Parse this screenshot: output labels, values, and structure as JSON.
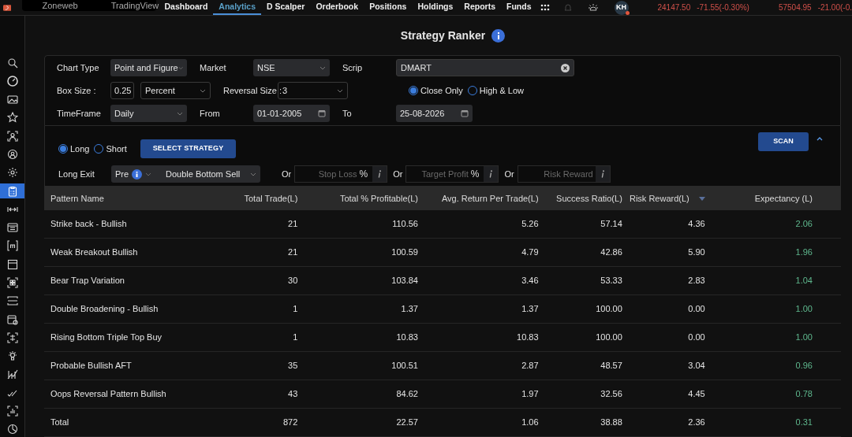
{
  "top_bar": {
    "shortcuts": [
      "Zoneweb",
      "TradingView"
    ],
    "nav": [
      {
        "label": "Dashboard",
        "selected": false
      },
      {
        "label": "Analytics",
        "selected": true
      },
      {
        "label": "D Scalper",
        "selected": false
      },
      {
        "label": "Orderbook",
        "selected": false
      },
      {
        "label": "Positions",
        "selected": false
      },
      {
        "label": "Holdings",
        "selected": false
      },
      {
        "label": "Reports",
        "selected": false
      },
      {
        "label": "Funds",
        "selected": false
      }
    ],
    "avatar": "KH",
    "tickers": [
      {
        "price": "24147.50",
        "change": "-71.55(-0.30%)"
      },
      {
        "price": "57504.95",
        "change": "-21.00(-0."
      }
    ]
  },
  "sidebar": {
    "items": [
      {
        "selected": false
      },
      {
        "selected": false
      },
      {
        "selected": false
      },
      {
        "selected": false
      },
      {
        "selected": false
      },
      {
        "selected": false
      },
      {
        "selected": false
      },
      {
        "selected": true
      },
      {
        "selected": false
      },
      {
        "selected": false
      },
      {
        "selected": false
      },
      {
        "selected": false
      },
      {
        "selected": false
      },
      {
        "selected": false
      },
      {
        "selected": false
      },
      {
        "selected": false
      },
      {
        "selected": false
      },
      {
        "selected": false
      },
      {
        "selected": false
      },
      {
        "selected": false
      },
      {
        "selected": false
      }
    ]
  },
  "title": "Strategy Ranker",
  "settings": {
    "chart_type": {
      "label": "Chart Type",
      "value": "Point and Figure"
    },
    "market": {
      "label": "Market",
      "value": "NSE"
    },
    "scrip": {
      "label": "Scrip",
      "value": "DMART"
    },
    "box_size": {
      "label": "Box Size :",
      "value": "0.25",
      "unit": "Percent"
    },
    "reversal_size": {
      "label": "Reversal Size :",
      "value": "3"
    },
    "price_mode": [
      {
        "label": "Close Only",
        "selected": true
      },
      {
        "label": "High & Low",
        "selected": false
      }
    ],
    "timeframe": {
      "label": "TimeFrame",
      "value": "Daily"
    },
    "from": {
      "label": "From",
      "value": "01-01-2005"
    },
    "to": {
      "label": "To",
      "value": "25-08-2026"
    }
  },
  "strategy": {
    "direction": [
      {
        "label": "Long",
        "selected": true
      },
      {
        "label": "Short",
        "selected": false
      }
    ],
    "select_button": "SELECT STRATEGY",
    "scan_button": "SCAN",
    "exit_label": "Long Exit",
    "exit_mode": "Pre",
    "exit_pattern": "Double Bottom Sell",
    "or_fields": [
      {
        "or": "Or",
        "placeholder": "Stop Loss",
        "suffix": "%"
      },
      {
        "or": "Or",
        "placeholder": "Target Profit",
        "suffix": "%"
      },
      {
        "or": "Or",
        "placeholder": "Risk Reward"
      }
    ]
  },
  "table": {
    "columns": [
      "Pattern Name",
      "Total Trade(L)",
      "Total % Profitable(L)",
      "Avg. Return Per Trade(L)",
      "Success Ratio(L)",
      "Risk Reward(L)",
      "Expectancy (L)"
    ],
    "rows": [
      [
        "Strike back - Bullish",
        "21",
        "110.56",
        "5.26",
        "57.14",
        "4.36",
        "2.06"
      ],
      [
        "Weak Breakout Bullish",
        "21",
        "100.59",
        "4.79",
        "42.86",
        "5.90",
        "1.96"
      ],
      [
        "Bear Trap Variation",
        "30",
        "103.84",
        "3.46",
        "53.33",
        "2.83",
        "1.04"
      ],
      [
        "Double Broadening - Bullish",
        "1",
        "1.37",
        "1.37",
        "100.00",
        "0.00",
        "1.00"
      ],
      [
        "Rising Bottom Triple Top Buy",
        "1",
        "10.83",
        "10.83",
        "100.00",
        "0.00",
        "1.00"
      ],
      [
        "Probable Bullish AFT",
        "35",
        "100.51",
        "2.87",
        "48.57",
        "3.04",
        "0.96"
      ],
      [
        "Oops Reversal Pattern Bullish",
        "43",
        "84.62",
        "1.97",
        "32.56",
        "4.45",
        "0.78"
      ],
      [
        "Total",
        "872",
        "22.57",
        "1.06",
        "38.88",
        "2.36",
        "0.31"
      ]
    ]
  }
}
